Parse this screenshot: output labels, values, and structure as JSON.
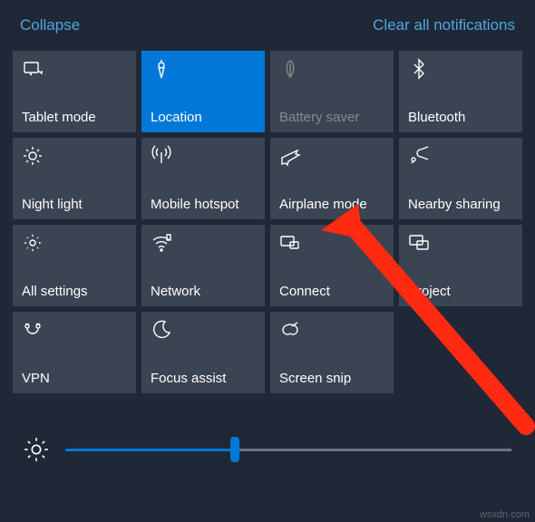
{
  "header": {
    "collapse": "Collapse",
    "clear": "Clear all notifications"
  },
  "tiles": [
    {
      "id": "tablet-mode",
      "label": "Tablet mode",
      "icon": "tablet-icon",
      "state": "normal"
    },
    {
      "id": "location",
      "label": "Location",
      "icon": "location-icon",
      "state": "active"
    },
    {
      "id": "battery-saver",
      "label": "Battery saver",
      "icon": "leaf-icon",
      "state": "disabled"
    },
    {
      "id": "bluetooth",
      "label": "Bluetooth",
      "icon": "bluetooth-icon",
      "state": "normal"
    },
    {
      "id": "night-light",
      "label": "Night light",
      "icon": "sun-icon",
      "state": "normal"
    },
    {
      "id": "mobile-hotspot",
      "label": "Mobile hotspot",
      "icon": "hotspot-icon",
      "state": "normal"
    },
    {
      "id": "airplane-mode",
      "label": "Airplane mode",
      "icon": "airplane-icon",
      "state": "normal"
    },
    {
      "id": "nearby-sharing",
      "label": "Nearby sharing",
      "icon": "share-icon",
      "state": "normal"
    },
    {
      "id": "all-settings",
      "label": "All settings",
      "icon": "gear-icon",
      "state": "normal"
    },
    {
      "id": "network",
      "label": "Network",
      "icon": "wifi-icon",
      "state": "normal"
    },
    {
      "id": "connect",
      "label": "Connect",
      "icon": "connect-icon",
      "state": "normal"
    },
    {
      "id": "project",
      "label": "Project",
      "icon": "project-icon",
      "state": "normal"
    },
    {
      "id": "vpn",
      "label": "VPN",
      "icon": "vpn-icon",
      "state": "normal"
    },
    {
      "id": "focus-assist",
      "label": "Focus assist",
      "icon": "moon-icon",
      "state": "normal"
    },
    {
      "id": "screen-snip",
      "label": "Screen snip",
      "icon": "snip-icon",
      "state": "normal"
    }
  ],
  "brightness": {
    "percent": 38
  },
  "annotation": {
    "arrow_target": "airplane-mode",
    "arrow_color": "#ff2a12"
  },
  "watermark": "wsxdn.com"
}
